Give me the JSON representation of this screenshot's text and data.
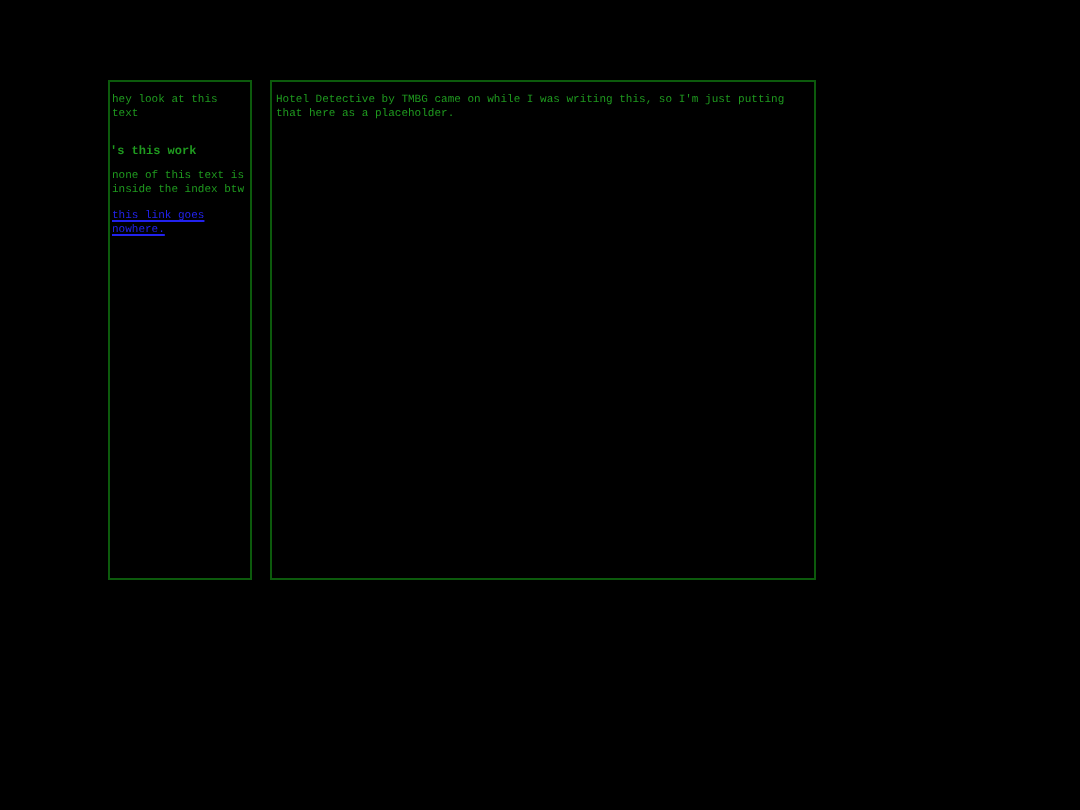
{
  "sidebar": {
    "intro": "hey look at this text",
    "heading": "'s this work",
    "note": "none of this text is inside the index btw",
    "link": "this link goes nowhere."
  },
  "main": {
    "text": "Hotel Detective by TMBG came on while I was writing this, so I'm just putting that here as a placeholder."
  }
}
